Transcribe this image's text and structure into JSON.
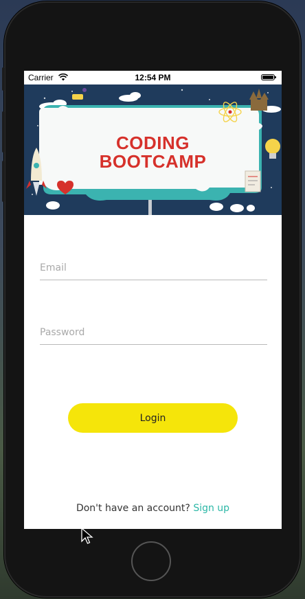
{
  "status_bar": {
    "carrier": "Carrier",
    "time": "12:54 PM"
  },
  "banner": {
    "title_line1": "CODING",
    "title_line2": "BOOTCAMP"
  },
  "form": {
    "email_placeholder": "Email",
    "password_placeholder": "Password",
    "login_label": "Login"
  },
  "footer": {
    "prompt": "Don't have an account? ",
    "signup_label": "Sign up"
  },
  "colors": {
    "login_button": "#f5e50a",
    "signup_link": "#2bb7a6",
    "banner_title": "#d6312b",
    "banner_background": "#1f3b5c"
  },
  "icons": [
    "wifi-icon",
    "battery-icon",
    "rocket-icon",
    "heart-icon",
    "atom-icon",
    "lightbulb-icon",
    "castle-icon",
    "document-icon",
    "cursor-icon"
  ]
}
